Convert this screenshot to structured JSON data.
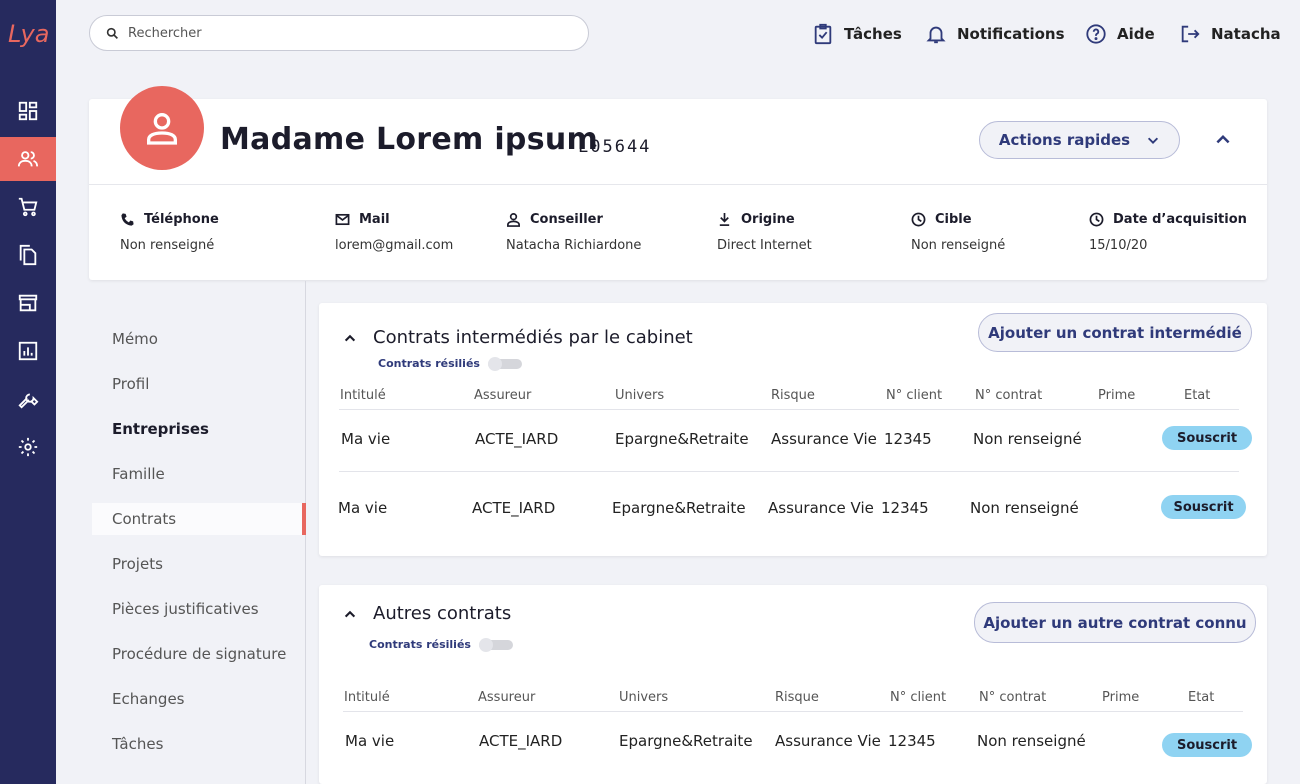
{
  "app": {
    "logo_text": "Lya"
  },
  "sidebar": {
    "items": [
      {
        "icon": "dashboard-icon"
      },
      {
        "icon": "clients-icon",
        "active": true
      },
      {
        "icon": "cart-icon"
      },
      {
        "icon": "documents-icon"
      },
      {
        "icon": "store-icon"
      },
      {
        "icon": "chart-icon"
      },
      {
        "icon": "wrench-icon"
      },
      {
        "icon": "gear-icon"
      }
    ]
  },
  "search": {
    "placeholder": "Rechercher"
  },
  "topbar": {
    "tasks": "Tâches",
    "notifications": "Notifications",
    "help": "Aide",
    "user": "Natacha"
  },
  "client": {
    "name": "Madame Lorem ipsum",
    "ref": "L05644",
    "actions_label": "Actions rapides",
    "info": [
      {
        "icon": "phone-icon",
        "label": "Téléphone",
        "value": "Non renseigné"
      },
      {
        "icon": "mail-icon",
        "label": "Mail",
        "value": "lorem@gmail.com"
      },
      {
        "icon": "person-icon",
        "label": "Conseiller",
        "value": "Natacha Richiardone"
      },
      {
        "icon": "download-icon",
        "label": "Origine",
        "value": "Direct Internet"
      },
      {
        "icon": "clock-icon",
        "label": "Cible",
        "value": "Non renseigné"
      },
      {
        "icon": "clock-icon",
        "label": "Date d’acquisition",
        "value": "15/10/20"
      }
    ]
  },
  "menu": {
    "items": [
      {
        "label": "Mémo"
      },
      {
        "label": "Profil"
      },
      {
        "label": "Entreprises",
        "bold": true
      },
      {
        "label": "Famille"
      },
      {
        "label": "Contrats",
        "active": true
      },
      {
        "label": "Projets"
      },
      {
        "label": "Pièces justificatives"
      },
      {
        "label": "Procédure de signature"
      },
      {
        "label": "Echanges"
      },
      {
        "label": "Tâches"
      }
    ]
  },
  "columns": [
    "Intitulé",
    "Assureur",
    "Univers",
    "Risque",
    "N° client",
    "N° contrat",
    "Prime",
    "Etat"
  ],
  "sections": [
    {
      "title": "Contrats intermédiés par le cabinet",
      "toggle_label": "Contrats résiliés",
      "add_label": "Ajouter un contrat intermédié",
      "rows": [
        {
          "intitule": "Ma vie",
          "assureur": "ACTE_IARD",
          "univers": "Epargne&Retraite",
          "risque": "Assurance Vie",
          "client": "12345",
          "contrat": "Non renseigné",
          "prime": "",
          "etat": "Souscrit"
        },
        {
          "intitule": "Ma vie",
          "assureur": "ACTE_IARD",
          "univers": "Epargne&Retraite",
          "risque": "Assurance Vie",
          "client": "12345",
          "contrat": "Non renseigné",
          "prime": "",
          "etat": "Souscrit"
        }
      ]
    },
    {
      "title": "Autres contrats",
      "toggle_label": "Contrats résiliés",
      "add_label": "Ajouter un autre contrat connu",
      "rows": [
        {
          "intitule": "Ma vie",
          "assureur": "ACTE_IARD",
          "univers": "Epargne&Retraite",
          "risque": "Assurance Vie",
          "client": "12345",
          "contrat": "Non renseigné",
          "prime": "",
          "etat": "Souscrit"
        }
      ]
    }
  ],
  "colors": {
    "sidebar": "#262a5e",
    "accent": "#e8675f",
    "primary_text": "#2f3a7a",
    "badge": "#8fd3f2"
  }
}
